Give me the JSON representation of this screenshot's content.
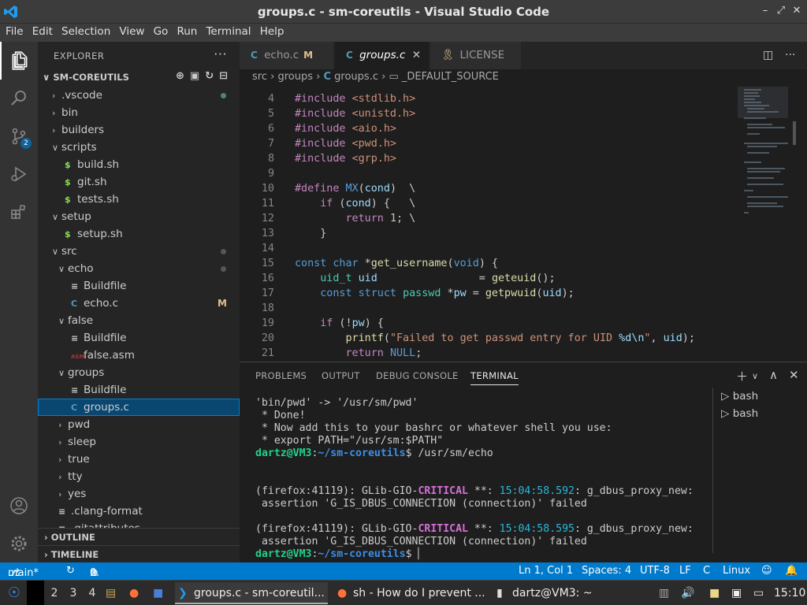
{
  "window": {
    "title": "groups.c - sm-coreutils - Visual Studio Code",
    "minimize": "–",
    "restore": "⤢",
    "close": "✕"
  },
  "menu": [
    "File",
    "Edit",
    "Selection",
    "View",
    "Go",
    "Run",
    "Terminal",
    "Help"
  ],
  "activity": {
    "scm_badge": "2"
  },
  "explorer": {
    "header": "EXPLORER",
    "more": "···",
    "project": "SM-COREUTILS",
    "tree": [
      {
        "label": ".vscode",
        "type": "folder",
        "open": false,
        "depth": 0,
        "dot": "green"
      },
      {
        "label": "bin",
        "type": "folder",
        "open": false,
        "depth": 0
      },
      {
        "label": "builders",
        "type": "folder",
        "open": false,
        "depth": 0
      },
      {
        "label": "scripts",
        "type": "folder",
        "open": true,
        "depth": 0
      },
      {
        "label": "build.sh",
        "type": "sh",
        "depth": 1
      },
      {
        "label": "git.sh",
        "type": "sh",
        "depth": 1
      },
      {
        "label": "tests.sh",
        "type": "sh",
        "depth": 1
      },
      {
        "label": "setup",
        "type": "folder",
        "open": true,
        "depth": 0
      },
      {
        "label": "setup.sh",
        "type": "sh",
        "depth": 1
      },
      {
        "label": "src",
        "type": "folder",
        "open": true,
        "depth": 0,
        "dot": "gray"
      },
      {
        "label": "echo",
        "type": "folder",
        "open": true,
        "depth": 1,
        "dot": "gray"
      },
      {
        "label": "Buildfile",
        "type": "build",
        "depth": 2
      },
      {
        "label": "echo.c",
        "type": "c",
        "depth": 2,
        "mark": "M"
      },
      {
        "label": "false",
        "type": "folder",
        "open": true,
        "depth": 1
      },
      {
        "label": "Buildfile",
        "type": "build",
        "depth": 2
      },
      {
        "label": "false.asm",
        "type": "asm",
        "depth": 2
      },
      {
        "label": "groups",
        "type": "folder",
        "open": true,
        "depth": 1
      },
      {
        "label": "Buildfile",
        "type": "build",
        "depth": 2
      },
      {
        "label": "groups.c",
        "type": "c",
        "depth": 2,
        "selected": true
      },
      {
        "label": "pwd",
        "type": "folder",
        "open": false,
        "depth": 1
      },
      {
        "label": "sleep",
        "type": "folder",
        "open": false,
        "depth": 1
      },
      {
        "label": "true",
        "type": "folder",
        "open": false,
        "depth": 1
      },
      {
        "label": "tty",
        "type": "folder",
        "open": false,
        "depth": 1
      },
      {
        "label": "yes",
        "type": "folder",
        "open": false,
        "depth": 1
      },
      {
        "label": ".clang-format",
        "type": "text",
        "depth": 0
      },
      {
        "label": ".gitattributes",
        "type": "text",
        "depth": 0
      }
    ],
    "outline": "OUTLINE",
    "timeline": "TIMELINE"
  },
  "tabs": [
    {
      "label": "echo.c",
      "modified": "M",
      "active": false
    },
    {
      "label": "groups.c",
      "active": true,
      "close": "✕"
    },
    {
      "label": "LICENSE",
      "active": false
    }
  ],
  "breadcrumb": [
    "src",
    "groups",
    "groups.c",
    "_DEFAULT_SOURCE"
  ],
  "code": [
    {
      "n": "4",
      "t": [
        [
          "pp",
          "#include "
        ],
        [
          "str",
          "<stdlib.h>"
        ]
      ]
    },
    {
      "n": "5",
      "t": [
        [
          "pp",
          "#include "
        ],
        [
          "str",
          "<unistd.h>"
        ]
      ]
    },
    {
      "n": "6",
      "t": [
        [
          "pp",
          "#include "
        ],
        [
          "str",
          "<aio.h>"
        ]
      ]
    },
    {
      "n": "7",
      "t": [
        [
          "pp",
          "#include "
        ],
        [
          "str",
          "<pwd.h>"
        ]
      ]
    },
    {
      "n": "8",
      "t": [
        [
          "pp",
          "#include "
        ],
        [
          "str",
          "<grp.h>"
        ]
      ]
    },
    {
      "n": "9",
      "t": []
    },
    {
      "n": "10",
      "t": [
        [
          "pp",
          "#define "
        ],
        [
          "mac",
          "MX"
        ],
        [
          "",
          "("
        ],
        [
          "va",
          "cond"
        ],
        [
          "",
          ")  \\"
        ]
      ]
    },
    {
      "n": "11",
      "t": [
        [
          "",
          "    "
        ],
        [
          "pp",
          "if"
        ],
        [
          "",
          " ("
        ],
        [
          "va",
          "cond"
        ],
        [
          "",
          ") {   \\"
        ]
      ]
    },
    {
      "n": "12",
      "t": [
        [
          "",
          "        "
        ],
        [
          "pp",
          "return"
        ],
        [
          "",
          " "
        ],
        [
          "num",
          "1"
        ],
        [
          "",
          "; \\"
        ]
      ]
    },
    {
      "n": "13",
      "t": [
        [
          "",
          "    }"
        ]
      ]
    },
    {
      "n": "14",
      "t": []
    },
    {
      "n": "15",
      "t": [
        [
          "kw",
          "const"
        ],
        [
          "",
          " "
        ],
        [
          "kw",
          "char"
        ],
        [
          "",
          " *"
        ],
        [
          "fn",
          "get_username"
        ],
        [
          "",
          "("
        ],
        [
          "kw",
          "void"
        ],
        [
          "",
          ") {"
        ]
      ]
    },
    {
      "n": "16",
      "t": [
        [
          "",
          "    "
        ],
        [
          "ty",
          "uid_t"
        ],
        [
          "",
          " "
        ],
        [
          "va",
          "uid"
        ],
        [
          "",
          "                = "
        ],
        [
          "fn",
          "geteuid"
        ],
        [
          "",
          "();"
        ]
      ]
    },
    {
      "n": "17",
      "t": [
        [
          "",
          "    "
        ],
        [
          "kw",
          "const"
        ],
        [
          "",
          " "
        ],
        [
          "kw",
          "struct"
        ],
        [
          "",
          " "
        ],
        [
          "ty",
          "passwd"
        ],
        [
          "",
          " *"
        ],
        [
          "va",
          "pw"
        ],
        [
          "",
          " = "
        ],
        [
          "fn",
          "getpwuid"
        ],
        [
          "",
          "("
        ],
        [
          "va",
          "uid"
        ],
        [
          "",
          ");"
        ]
      ]
    },
    {
      "n": "18",
      "t": []
    },
    {
      "n": "19",
      "t": [
        [
          "",
          "    "
        ],
        [
          "pp",
          "if"
        ],
        [
          "",
          " (!"
        ],
        [
          "va",
          "pw"
        ],
        [
          "",
          ") {"
        ]
      ]
    },
    {
      "n": "20",
      "t": [
        [
          "",
          "        "
        ],
        [
          "fn",
          "printf"
        ],
        [
          "",
          "("
        ],
        [
          "str",
          "\"Failed to get passwd entry for UID "
        ],
        [
          "fmt",
          "%d\\n"
        ],
        [
          "str",
          "\""
        ],
        [
          "",
          ", "
        ],
        [
          "va",
          "uid"
        ],
        [
          "",
          ");"
        ]
      ]
    },
    {
      "n": "21",
      "t": [
        [
          "",
          "        "
        ],
        [
          "pp",
          "return"
        ],
        [
          "",
          " "
        ],
        [
          "kw",
          "NULL"
        ],
        [
          "",
          ";"
        ]
      ]
    }
  ],
  "panel": {
    "tabs": [
      "PROBLEMS",
      "OUTPUT",
      "DEBUG CONSOLE",
      "TERMINAL"
    ],
    "active_tab": "TERMINAL",
    "terminals": [
      "bash",
      "bash"
    ]
  },
  "terminal": [
    [
      [
        "",
        "'bin/pwd' -> '/usr/sm/pwd'"
      ]
    ],
    [
      [
        "",
        " * Done!"
      ]
    ],
    [
      [
        "",
        " * Now add this to your bashrc or whatever shell you use:"
      ]
    ],
    [
      [
        "",
        " * export PATH=\"/usr/sm:$PATH\""
      ]
    ],
    [
      [
        "tg",
        "dartz@VM3"
      ],
      [
        "",
        ":"
      ],
      [
        "tb",
        "~/sm-coreutils"
      ],
      [
        "",
        "$ /usr/sm/echo"
      ]
    ],
    [],
    [],
    [
      [
        "",
        "(firefox:41119): GLib-GIO-"
      ],
      [
        "tm",
        "CRITICAL"
      ],
      [
        "",
        " **: "
      ],
      [
        "tc",
        "15:04:58.592"
      ],
      [
        "",
        ": g_dbus_proxy_new:"
      ]
    ],
    [
      [
        "",
        " assertion 'G_IS_DBUS_CONNECTION (connection)' failed"
      ]
    ],
    [],
    [
      [
        "",
        "(firefox:41119): GLib-GIO-"
      ],
      [
        "tm",
        "CRITICAL"
      ],
      [
        "",
        " **: "
      ],
      [
        "tc",
        "15:04:58.595"
      ],
      [
        "",
        ": g_dbus_proxy_new:"
      ]
    ],
    [
      [
        "",
        " assertion 'G_IS_DBUS_CONNECTION (connection)' failed"
      ]
    ],
    [
      [
        "tg",
        "dartz@VM3"
      ],
      [
        "",
        ":"
      ],
      [
        "tb",
        "~/sm-coreutils"
      ],
      [
        "",
        "$ "
      ],
      [
        "cursor",
        "▏"
      ]
    ]
  ],
  "statusbar": {
    "branch": "main*",
    "errors": "0",
    "warnings": "0",
    "position": "Ln 1, Col 1",
    "spaces": "Spaces: 4",
    "encoding": "UTF-8",
    "eol": "LF",
    "language": "C",
    "platform": "Linux"
  },
  "taskbar": {
    "workspaces": [
      "2",
      "3",
      "4"
    ],
    "windows": [
      {
        "label": "groups.c - sm-coreutil...",
        "active": true
      },
      {
        "label": "sh - How do I prevent ...",
        "active": false
      },
      {
        "label": "dartz@VM3: ~",
        "active": false
      }
    ],
    "clock": "15:10"
  },
  "colors": {
    "accent": "#007acc",
    "selection": "#094771"
  }
}
